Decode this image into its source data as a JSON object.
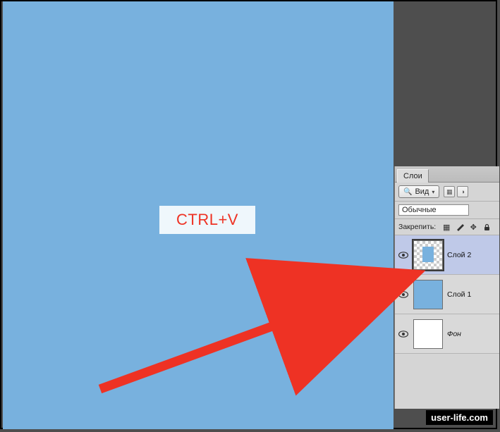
{
  "hint": {
    "label": "CTRL+V"
  },
  "panel": {
    "tab": "Слои",
    "filter_label": "Вид",
    "blend_mode": "Обычные",
    "lock_label": "Закрепить:"
  },
  "layers": [
    {
      "name": "Слой 2",
      "thumb": "small-blue",
      "selected": true,
      "italic": false
    },
    {
      "name": "Слой 1",
      "thumb": "full-blue",
      "selected": false,
      "italic": false
    },
    {
      "name": "Фон",
      "thumb": "white",
      "selected": false,
      "italic": true
    }
  ],
  "watermark": "user-life.com",
  "colors": {
    "canvas": "#78b1de",
    "arrow": "#ee3224"
  }
}
